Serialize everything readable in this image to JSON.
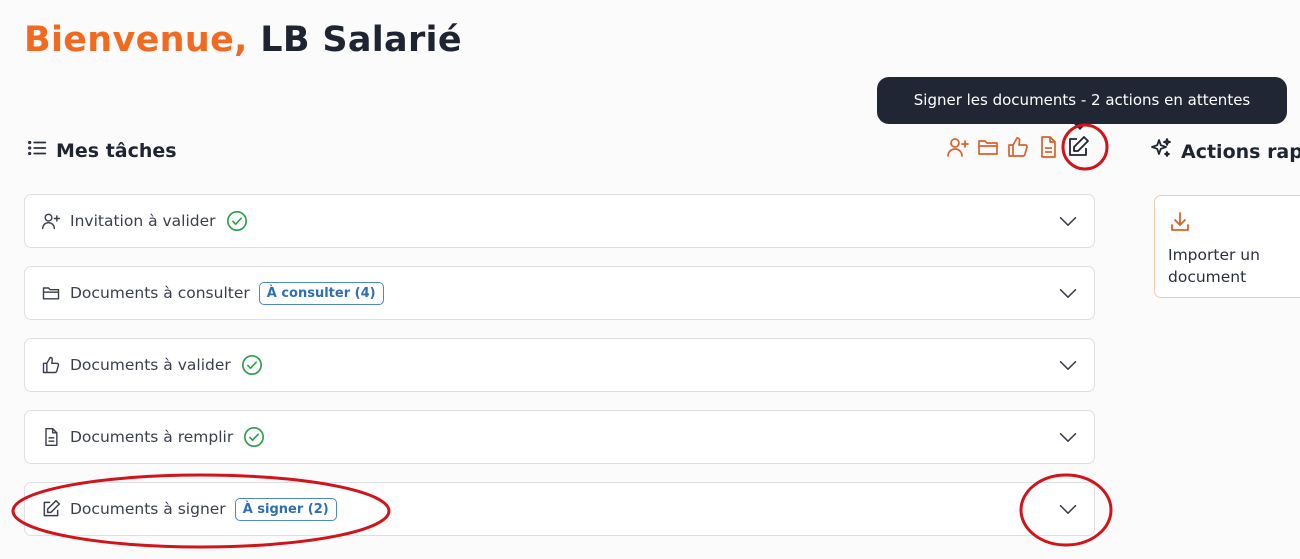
{
  "header": {
    "greeting": "Bienvenue,",
    "user_name": "LB Salarié"
  },
  "tooltip": {
    "text": "Signer les documents - 2 actions en attentes"
  },
  "tasks_section": {
    "title": "Mes tâches",
    "items": [
      {
        "label": "Invitation à valider",
        "status": "done"
      },
      {
        "label": "Documents à consulter",
        "badge": "À consulter (4)"
      },
      {
        "label": "Documents à valider",
        "status": "done"
      },
      {
        "label": "Documents à remplir",
        "status": "done"
      },
      {
        "label": "Documents à signer",
        "badge": "À signer (2)"
      }
    ]
  },
  "filter_icons": [
    "add-user-icon",
    "folder-icon",
    "thumbs-up-icon",
    "document-icon",
    "edit-icon"
  ],
  "quick_actions": {
    "title": "Actions rap",
    "import_label": "Importer un document"
  },
  "colors": {
    "accent": "#f26a1f",
    "success": "#2e9e4a",
    "badge_blue": "#2f6fb0",
    "annotation": "#d0141a"
  }
}
